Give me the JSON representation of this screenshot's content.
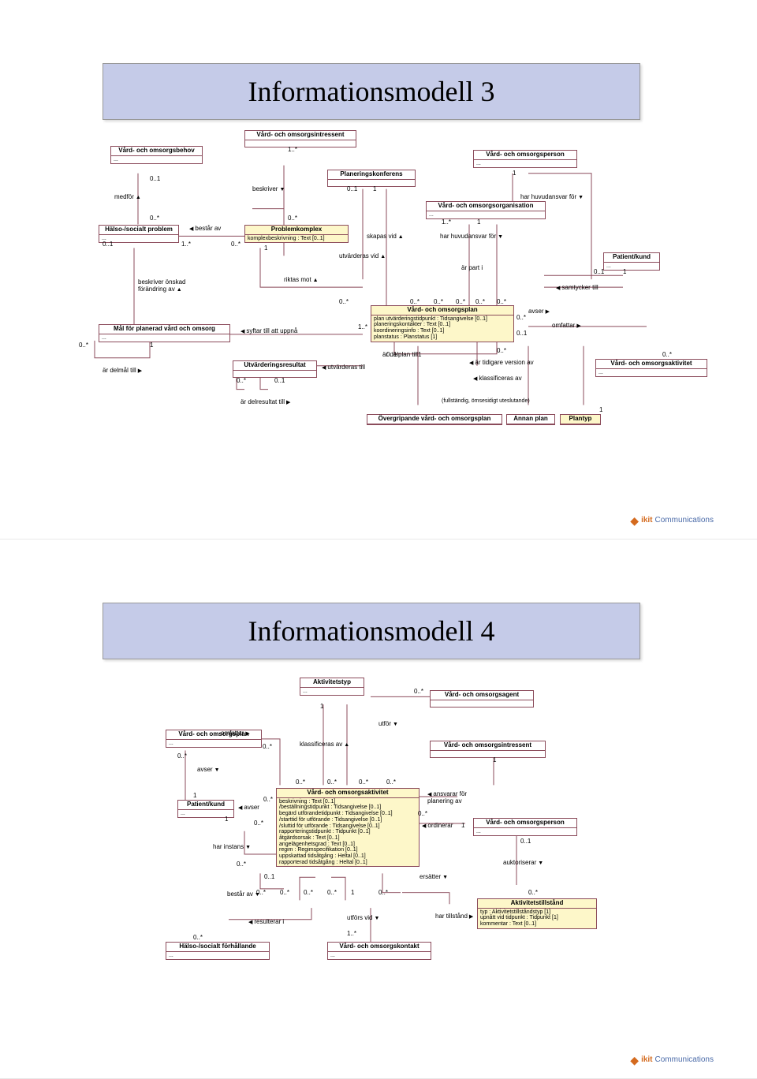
{
  "titles": {
    "slide1": "Informationsmodell 3",
    "slide2": "Informationsmodell 4"
  },
  "logo": {
    "brand": "ikit",
    "suffix": "Communications"
  },
  "slide1": {
    "classes": {
      "behov": {
        "name": "Vård- och omsorgsbehov",
        "body": "..."
      },
      "intressent": {
        "name": "Vård- och omsorgsintressent"
      },
      "person": {
        "name": "Vård- och omsorgsperson",
        "body": "..."
      },
      "problem": {
        "name": "Hälso-/socialt problem",
        "body": "..."
      },
      "komplex": {
        "name": "Problemkomplex",
        "attrs": "komplexbeskrivning : Text [0..1]"
      },
      "konferens": {
        "name": "Planeringskonferens"
      },
      "org": {
        "name": "Vård- och omsorgsorganisation",
        "body": "..."
      },
      "patient": {
        "name": "Patient/kund",
        "body": "..."
      },
      "mal": {
        "name": "Mål för planerad vård och omsorg",
        "body": "..."
      },
      "plan": {
        "name": "Vård- och omsorgsplan",
        "attrs": "plan utvärderingstidpunkt : Tidsangivelse [0..1]\nplaneringskontakter : Text [0..1]\nkoordineringsinfo : Text [0..1]\nplanstatus : Planstatus [1]"
      },
      "resultat": {
        "name": "Utvärderingsresultat"
      },
      "over": {
        "name": "Övergripande vård- och omsorgsplan"
      },
      "annan": {
        "name": "Annan plan"
      },
      "plantyp": {
        "name": "Plantyp"
      },
      "aktivitet": {
        "name": "Vård- och omsorgsaktivitet",
        "body": "..."
      }
    },
    "labels": {
      "medfor": "medför",
      "beskriver": "beskriver",
      "bestarav": "består av",
      "skapasvid": "skapas vid",
      "harhuvud": "har huvudansvar för",
      "arpart": "är part i",
      "riktasmot": "riktas mot",
      "utvarderasvid": "utvärderas vid",
      "beskrivonsk": "beskriver önskad\nförändring av",
      "samtycker": "samtycker till",
      "avser": "avser",
      "syftar": "syftar till att uppnå",
      "ardelmal": "är delmål till",
      "omfattar": "omfattar",
      "delplan": "är delplan till",
      "utvtill": "utvärderas till",
      "tidigare": "är tidigare version av",
      "klassif": "klassificeras av",
      "delresultat": "är delresultat till",
      "fullst": "(fullständig, ömsesidigt uteslutande)"
    }
  },
  "slide2": {
    "classes": {
      "aktivtyp": {
        "name": "Aktivitetstyp",
        "body": "..."
      },
      "agent": {
        "name": "Vård- och omsorgsagent"
      },
      "plan": {
        "name": "Vård- och omsorgsplan",
        "body": "..."
      },
      "intressent": {
        "name": "Vård- och omsorgsintressent"
      },
      "patient": {
        "name": "Patient/kund",
        "body": "..."
      },
      "aktivitet": {
        "name": "Vård- och omsorgsaktivitet",
        "attrs": "beskrivning : Text [0..1]\n/beställningstidpunkt : Tidsangivelse [0..1]\nbegärd utförandetidpunkt : Tidsangivelse [0..1]\n/starttid för utförande : Tidsangivelse [0..1]\n/sluttid för utförande : Tidsangivelse [0..1]\nrapporteringstidpunkt : Tidpunkt [0..1]\nåtgärdsorsak : Text [0..1]\nangelägenhetsgrad : Text [0..1]\nregim : Regimspecifikation [0..1]\nuppskattad tidsåtgång : Heltal [0..1]\nrapporterad tidsåtgång : Heltal [0..1]"
      },
      "person": {
        "name": "Vård- och omsorgsperson",
        "body": "..."
      },
      "forhall": {
        "name": "Hälso-/socialt förhållande",
        "body": "..."
      },
      "kontakt": {
        "name": "Vård- och omsorgskontakt",
        "body": "..."
      },
      "tillstand": {
        "name": "Aktivitetstillstånd",
        "attrs": "typ : Aktivitetstillståndstyp [1]\nupnått vid tidpunkt : Tidpunkt [1]\nkommentar : Text [0..1]"
      }
    },
    "labels": {
      "omfattar": "omfattar",
      "utfor": "utför",
      "klassif": "klassificeras av",
      "avser": "avser",
      "ansvarar": "ansvarar för\nplanering av",
      "harinst": "har instans",
      "ordinerar": "ordinerar",
      "bestar": "består av",
      "ersatter": "ersätter",
      "auktor": "auktoriserar",
      "resulterar": "resulterar i",
      "utforsvid": "utförs vid",
      "hartill": "har tillstånd"
    }
  }
}
